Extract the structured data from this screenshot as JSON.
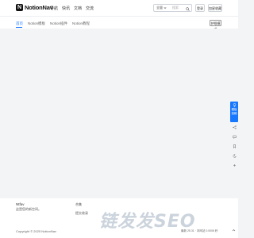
{
  "header": {
    "logo_mark": "N",
    "logo_text": "NotionNav",
    "nav": [
      "导航",
      "快讯",
      "文档",
      "交流"
    ],
    "search_select": "全量",
    "search_placeholder": "搜索",
    "login_label": "登录",
    "fav_label": "加星收藏"
  },
  "tabs": {
    "items": [
      "首页",
      "Notion模板",
      "Notion插件",
      "Notion教程"
    ],
    "active_index": 0,
    "theme_label": "护眼模式"
  },
  "float_bar": {
    "primary_label": "模板投稿",
    "items": [
      "share-icon",
      "message-icon",
      "bookmark-icon",
      "moon-icon",
      "plus-icon"
    ]
  },
  "footer": {
    "brand": "Ntfav",
    "desc": "这是您的新空间。",
    "link1": "合集",
    "link2": "提交收录",
    "copyright": "Copyright © 2025 NotionNav",
    "stats": "最新 25.31 · 本网站 0.0006 秒",
    "watermark": "链发发SEO"
  },
  "colors": {
    "accent": "#1677ff",
    "background": "#f3f4f6",
    "header_bg": "#ffffff"
  }
}
